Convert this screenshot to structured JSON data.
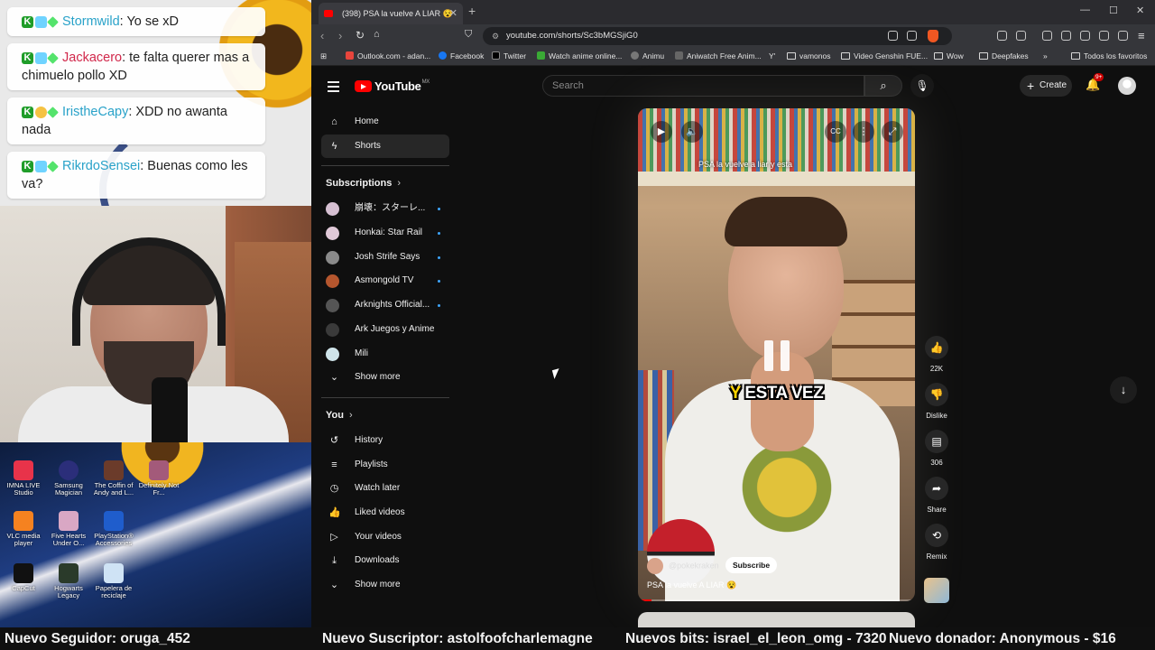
{
  "chat": {
    "messages": [
      {
        "user": "Stormwild",
        "text": ": Yo se xD"
      },
      {
        "user": "Jackacero",
        "text": ": te falta querer mas a chimuelo pollo XD"
      },
      {
        "user": "IristheCapy",
        "text": ": XDD no awanta nada"
      },
      {
        "user": "RikrdoSensei",
        "text": ": Buenas como les va?"
      }
    ]
  },
  "desktop": {
    "icons": [
      "IMNA LIVE Studio",
      "Samsung Magician",
      "The Coffin of Andy and L...",
      "Definitely Not Fr...",
      "VLC media player",
      "Five Hearts Under O...",
      "PlayStation® Accessories",
      "CapCut",
      "Hogwarts Legacy",
      "Papelera de reciclaje"
    ]
  },
  "browser": {
    "tab_title": "(398) PSA la vuelve A LIAR 😵",
    "url": "youtube.com/shorts/Sc3bMGSjiG0",
    "bookmarks": [
      "Outlook.com - adan...",
      "Facebook",
      "Twitter",
      "Watch anime online...",
      "Animu",
      "Aniwatch Free Anim...",
      "vamonos",
      "Video Genshin FUE...",
      "Wow",
      "Deepfakes",
      "Todos los favoritos"
    ]
  },
  "youtube": {
    "logo": "YouTube",
    "region": "MX",
    "search_placeholder": "Search",
    "create_label": "Create",
    "notifications": "9+",
    "sidebar": {
      "main": [
        {
          "label": "Home",
          "icon": "home-icon"
        },
        {
          "label": "Shorts",
          "icon": "shorts-icon"
        }
      ],
      "subscriptions_title": "Subscriptions",
      "subscriptions": [
        "崩壊：スターレ...",
        "Honkai: Star Rail",
        "Josh Strife Says",
        "Asmongold TV",
        "Arknights Official...",
        "Ark Juegos y Anime",
        "Mili"
      ],
      "show_more": "Show more",
      "you_title": "You",
      "you_items": [
        {
          "label": "History",
          "icon": "history-icon"
        },
        {
          "label": "Playlists",
          "icon": "playlists-icon"
        },
        {
          "label": "Watch later",
          "icon": "watch-later-icon"
        },
        {
          "label": "Liked videos",
          "icon": "liked-videos-icon"
        },
        {
          "label": "Your videos",
          "icon": "your-videos-icon"
        },
        {
          "label": "Downloads",
          "icon": "downloads-icon"
        }
      ],
      "show_more_2": "Show more"
    },
    "short": {
      "overlay_title": "PSA la vuelve a liar y esta",
      "caption_part1": "Y",
      "caption_part2": " ESTA VEZ",
      "channel": "@pokekraken",
      "subscribe": "Subscribe",
      "title": "PSA la vuelve A LIAR 😵",
      "progress": 0.05
    },
    "actions": {
      "likes": "22K",
      "dislike": "Dislike",
      "comments": "306",
      "share": "Share",
      "remix": "Remix"
    }
  },
  "ticker": {
    "follower": "Nuevo Seguidor: oruga_452",
    "subscriber": "Nuevo Suscriptor: astolfoofcharlemagne",
    "bits": "Nuevos bits: israel_el_leon_omg - 7320",
    "donor": "Nuevo donador: Anonymous - $16"
  }
}
